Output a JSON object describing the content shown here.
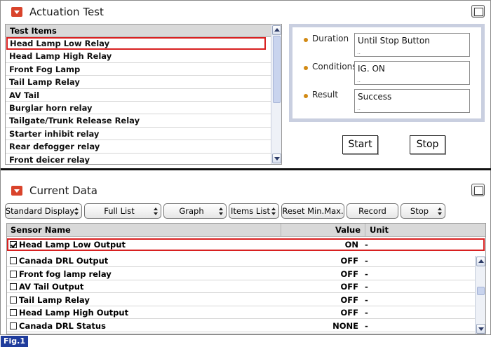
{
  "actuation": {
    "title": "Actuation Test",
    "list_header": "Test Items",
    "items": [
      "Head Lamp Low Relay",
      "Head Lamp High Relay",
      "Front Fog Lamp",
      "Tail Lamp Relay",
      "AV Tail",
      "Burglar horn relay",
      "Tailgate/Trunk Release Relay",
      "Starter inhibit relay",
      "Rear defogger relay",
      "Front deicer relay"
    ],
    "selected_index": 0,
    "info": {
      "duration_label": "Duration",
      "duration_value": "Until Stop Button",
      "conditions_label": "Conditions",
      "conditions_value": "IG. ON",
      "result_label": "Result",
      "result_value": "Success"
    },
    "start_label": "Start",
    "stop_label": "Stop"
  },
  "current_data": {
    "title": "Current Data",
    "toolbar": {
      "standard_display": "Standard Display",
      "full_list": "Full List",
      "graph": "Graph",
      "items_list": "Items List",
      "reset_minmax": "Reset Min.Max.",
      "record": "Record",
      "stop": "Stop"
    },
    "columns": {
      "name": "Sensor Name",
      "value": "Value",
      "unit": "Unit"
    },
    "rows": [
      {
        "name": "Head Lamp Low Output",
        "value": "ON",
        "unit": "-",
        "checked": true
      },
      {
        "name": "Canada DRL Output",
        "value": "OFF",
        "unit": "-",
        "checked": false
      },
      {
        "name": "Front fog lamp relay",
        "value": "OFF",
        "unit": "-",
        "checked": false
      },
      {
        "name": "AV Tail Output",
        "value": "OFF",
        "unit": "-",
        "checked": false
      },
      {
        "name": "Tail Lamp Relay",
        "value": "OFF",
        "unit": "-",
        "checked": false
      },
      {
        "name": "Head Lamp High Output",
        "value": "OFF",
        "unit": "-",
        "checked": false
      },
      {
        "name": "Canada DRL Status",
        "value": "NONE",
        "unit": "-",
        "checked": false
      }
    ]
  },
  "figure_label": "Fig.1",
  "colors": {
    "accent_red": "#d9432b",
    "highlight_red": "#d82020",
    "bullet_orange": "#d28a14",
    "fig_blue": "#1f3c9c",
    "info_box_bg": "#c9cfe0"
  }
}
